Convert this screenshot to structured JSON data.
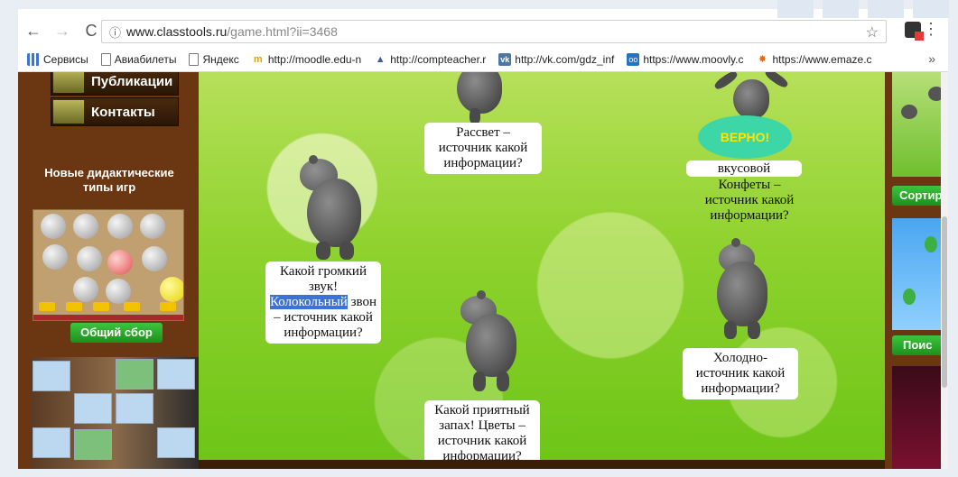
{
  "browser": {
    "url_host": "www.classtools.ru",
    "url_path": "/game.html?ii=3468",
    "bookmarks": [
      {
        "icon": "apps-icon",
        "label": "Сервисы"
      },
      {
        "icon": "page-icon",
        "label": "Авиабилеты"
      },
      {
        "icon": "page-icon",
        "label": "Яндекс"
      },
      {
        "icon": "moodle-icon",
        "label": "http://moodle.edu-n"
      },
      {
        "icon": "compteacher-icon",
        "label": "http://compteacher.r"
      },
      {
        "icon": "vk-icon",
        "label": "http://vk.com/gdz_inf"
      },
      {
        "icon": "moovly-icon",
        "label": "https://www.moovly.c"
      },
      {
        "icon": "emaze-icon",
        "label": "https://www.emaze.c"
      }
    ],
    "more_label": "»"
  },
  "sidebar": {
    "menu": [
      {
        "label": "Публикации"
      },
      {
        "label": "Контакты"
      }
    ],
    "promo_title": "Новые дидактические типы игр",
    "promo1_button": "Общий сбор"
  },
  "right_sidebar": {
    "button1": "Сортир",
    "button2": "Поис"
  },
  "game": {
    "cards": {
      "rassvet": "Рассвет – источник какой информации?",
      "konfety_top": "вкусовой",
      "konfety": "Конфеты – источник какой информации?",
      "zvon_pre": "Какой громкий звук!",
      "zvon_hl": "Колокольный",
      "zvon_post": "звон – источник какой информации?",
      "holodno": "Холодно- источник какой информации?",
      "zapah": "Какой приятный запах! Цветы – источник какой информации?"
    },
    "feedback": "ВЕРНО!"
  },
  "colors": {
    "brown": "#6b3712",
    "green_top": "#b6e05a",
    "green_bottom": "#6ec518",
    "highlight": "#3b71d8",
    "feedback_bg": "#3dd6a6",
    "feedback_text": "#ffe600"
  }
}
